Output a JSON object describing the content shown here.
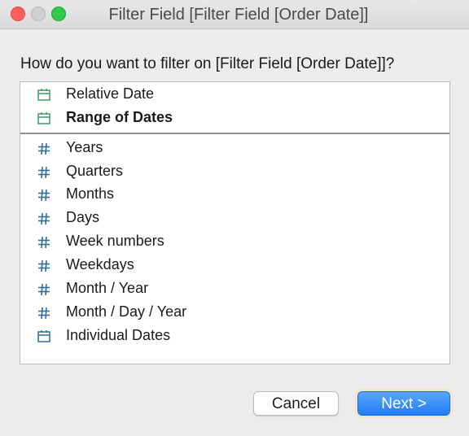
{
  "window": {
    "title": "Filter Field [Filter Field [Order Date]]"
  },
  "dialog": {
    "question": "How do you want to filter on [Filter Field [Order Date]]?",
    "date_options": [
      {
        "label": "Relative Date",
        "icon": "calendar-icon",
        "icon_color": "#3a9a6b",
        "bold": false
      },
      {
        "label": "Range of Dates",
        "icon": "calendar-icon",
        "icon_color": "#3a9a6b",
        "bold": true
      }
    ],
    "part_options": [
      {
        "label": "Years",
        "icon": "hash-icon",
        "icon_color": "#2f6f9a"
      },
      {
        "label": "Quarters",
        "icon": "hash-icon",
        "icon_color": "#2f6f9a"
      },
      {
        "label": "Months",
        "icon": "hash-icon",
        "icon_color": "#2f6f9a"
      },
      {
        "label": "Days",
        "icon": "hash-icon",
        "icon_color": "#2f6f9a"
      },
      {
        "label": "Week numbers",
        "icon": "hash-icon",
        "icon_color": "#2f6f9a"
      },
      {
        "label": "Weekdays",
        "icon": "hash-icon",
        "icon_color": "#2f6f9a"
      },
      {
        "label": "Month / Year",
        "icon": "hash-icon",
        "icon_color": "#2f6f9a"
      },
      {
        "label": "Month / Day / Year",
        "icon": "hash-icon",
        "icon_color": "#2f6f9a"
      },
      {
        "label": "Individual Dates",
        "icon": "calendar-icon",
        "icon_color": "#2f6f9a"
      }
    ],
    "buttons": {
      "cancel": "Cancel",
      "next": "Next >"
    }
  },
  "colors": {
    "accent": "#1f7df5",
    "close": "#fc605c",
    "maximize": "#34c84a"
  }
}
